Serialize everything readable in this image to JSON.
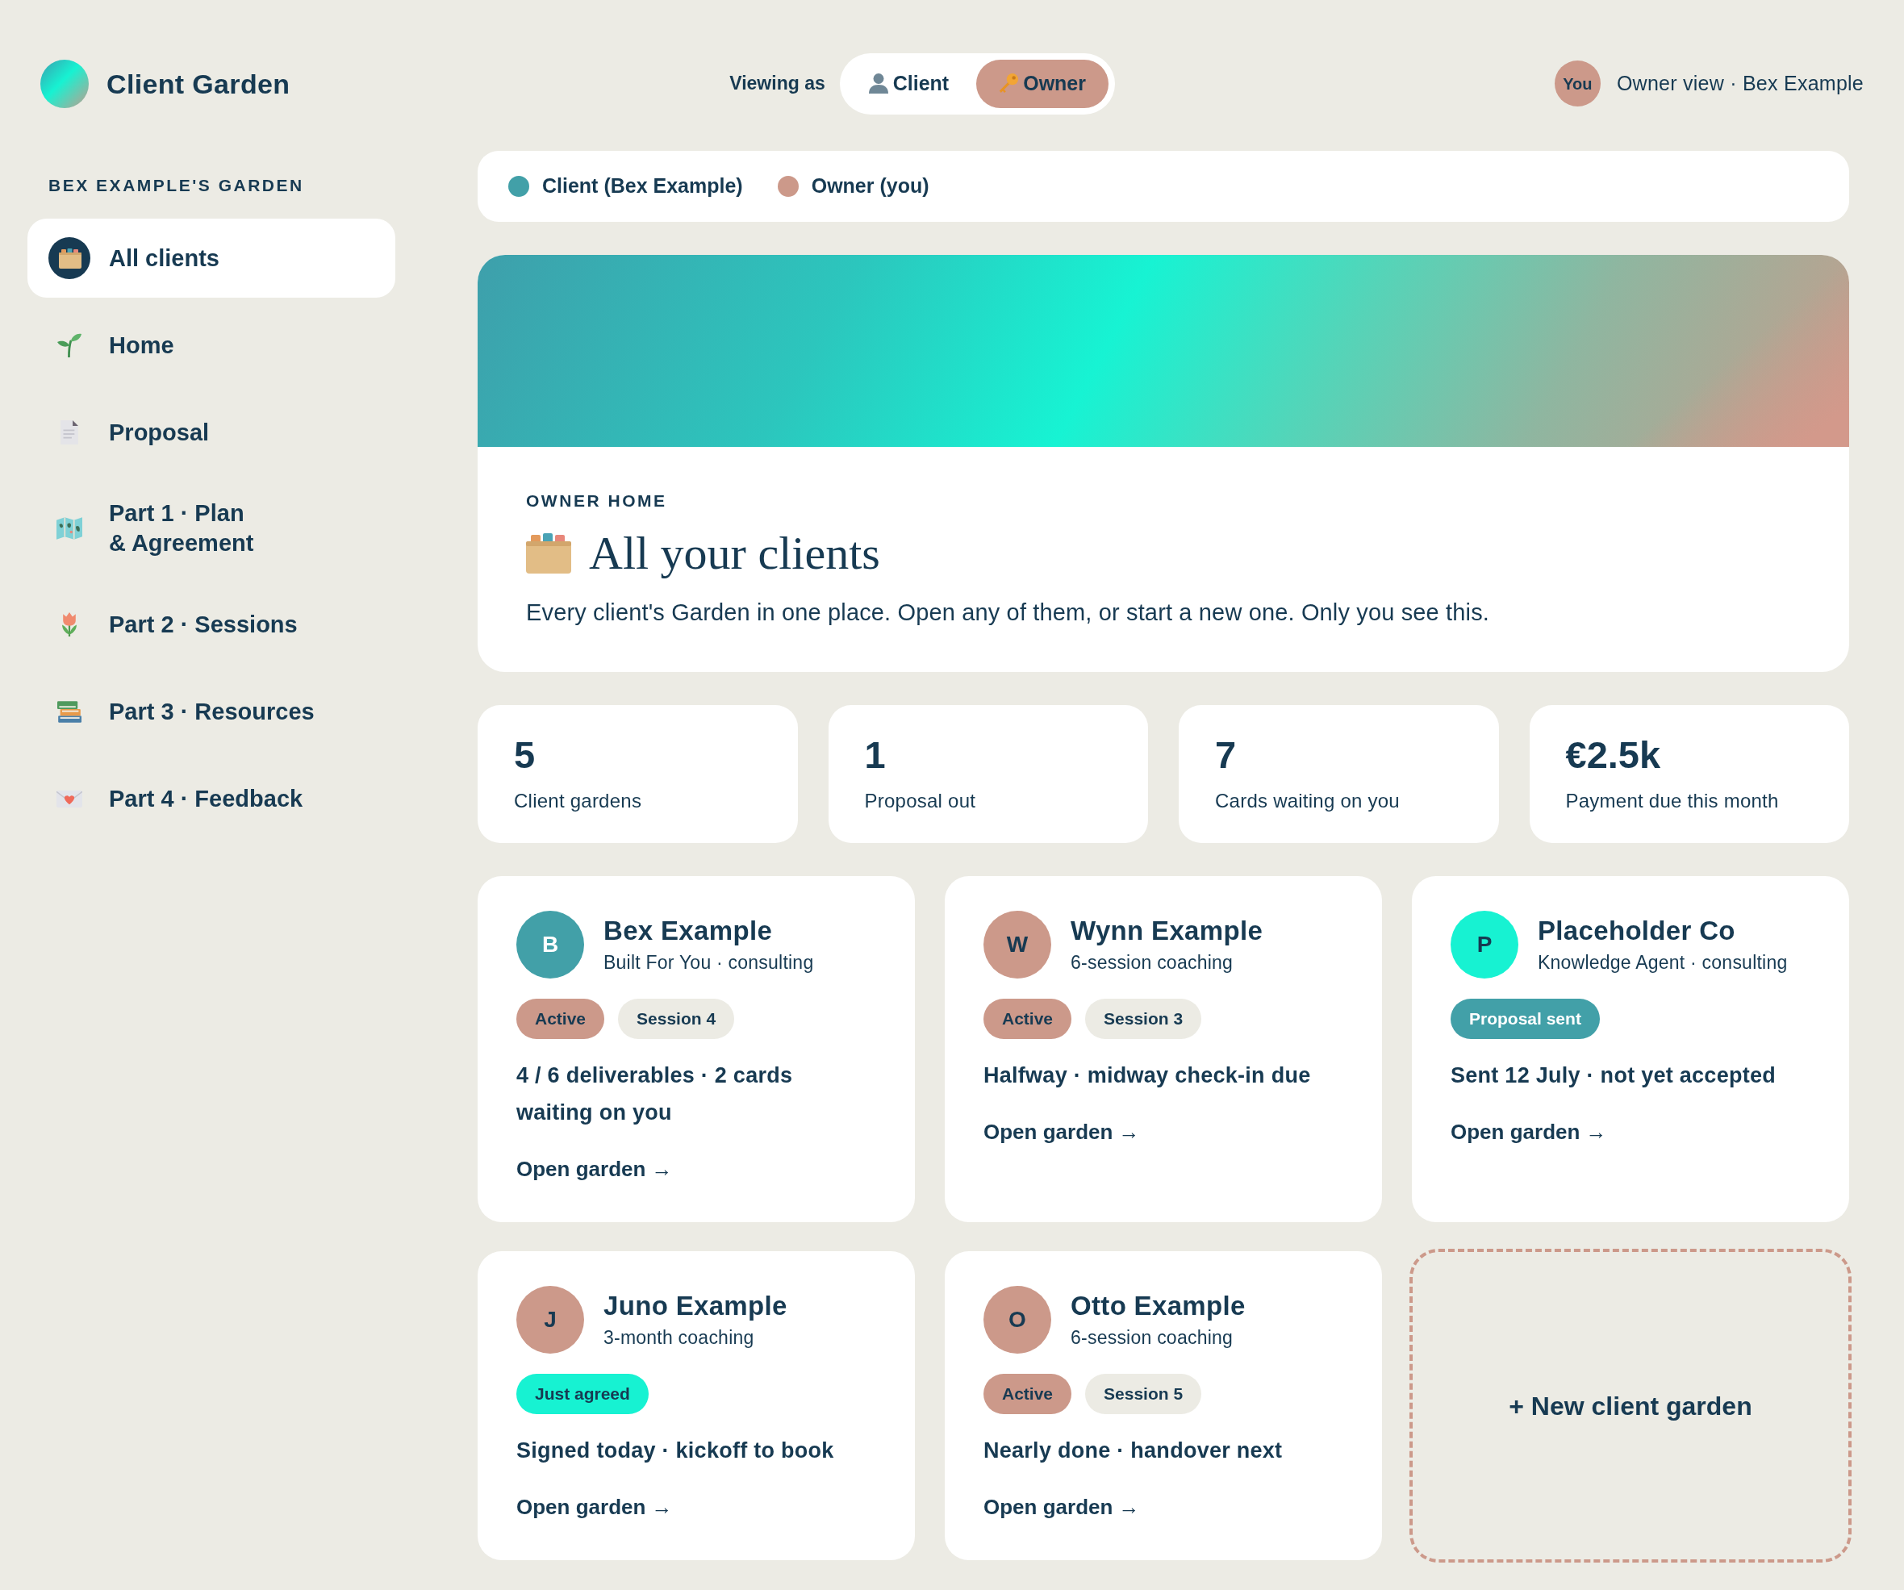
{
  "header": {
    "brand": "Client Garden",
    "viewing_label": "Viewing as",
    "view_options": [
      {
        "label": "Client",
        "selected": false
      },
      {
        "label": "Owner",
        "selected": true
      }
    ],
    "user": {
      "avatar": "You",
      "caption": "Owner view · Bex Example"
    }
  },
  "sidebar": {
    "heading": "BEX EXAMPLE'S GARDEN",
    "items": [
      {
        "label": "All clients",
        "selected": true
      },
      {
        "label": "Home",
        "selected": false
      },
      {
        "label": "Proposal",
        "selected": false
      },
      {
        "label": "Part 1 · Plan\n& Agreement",
        "selected": false
      },
      {
        "label": "Part 2 · Sessions",
        "selected": false
      },
      {
        "label": "Part 3 · Resources",
        "selected": false
      },
      {
        "label": "Part 4 · Feedback",
        "selected": false
      }
    ]
  },
  "legend": [
    {
      "label": "Client (Bex Example)",
      "color": "#42a0a8"
    },
    {
      "label": "Owner (you)",
      "color": "#cc998a"
    }
  ],
  "hero": {
    "eyebrow": "OWNER HOME",
    "title": "All your clients",
    "description": "Every client's Garden in one place. Open any of them, or start a new one. Only you see this."
  },
  "stats": [
    {
      "value": "5",
      "label": "Client gardens"
    },
    {
      "value": "1",
      "label": "Proposal out"
    },
    {
      "value": "7",
      "label": "Cards waiting on you"
    },
    {
      "value": "€2.5k",
      "label": "Payment due this month"
    }
  ],
  "clients": [
    {
      "initial": "B",
      "color": "#42a0a8",
      "name": "Bex Example",
      "subtitle": "Built For You · consulting",
      "tags": [
        {
          "label": "Active",
          "color": "#cc998a"
        },
        {
          "label": "Session 4",
          "color": "#ecebe4"
        }
      ],
      "summary": "4 / 6 deliverables · 2 cards waiting on you",
      "link": "Open garden →"
    },
    {
      "initial": "W",
      "color": "#cc998a",
      "name": "Wynn Example",
      "subtitle": "6-session coaching",
      "tags": [
        {
          "label": "Active",
          "color": "#cc998a"
        },
        {
          "label": "Session 3",
          "color": "#ecebe4"
        }
      ],
      "summary": "Halfway · midway check-in due",
      "link": "Open garden →"
    },
    {
      "initial": "P",
      "color": "#17f2d2",
      "name": "Placeholder Co",
      "subtitle": "Knowledge Agent · consulting",
      "tags": [
        {
          "label": "Proposal sent",
          "color": "#42a0a8"
        }
      ],
      "summary": "Sent 12 July · not yet accepted",
      "link": "Open garden →"
    },
    {
      "initial": "J",
      "color": "#cc998a",
      "name": "Juno Example",
      "subtitle": "3-month coaching",
      "tags": [
        {
          "label": "Just agreed",
          "color": "#17f2d2"
        }
      ],
      "summary": "Signed today · kickoff to book",
      "link": "Open garden →"
    },
    {
      "initial": "O",
      "color": "#cc998a",
      "name": "Otto Example",
      "subtitle": "6-session coaching",
      "tags": [
        {
          "label": "Active",
          "color": "#cc998a"
        },
        {
          "label": "Session 5",
          "color": "#ecebe4"
        }
      ],
      "summary": "Nearly done · handover next",
      "link": "Open garden →"
    }
  ],
  "new_client": {
    "label": "+ New client garden"
  }
}
